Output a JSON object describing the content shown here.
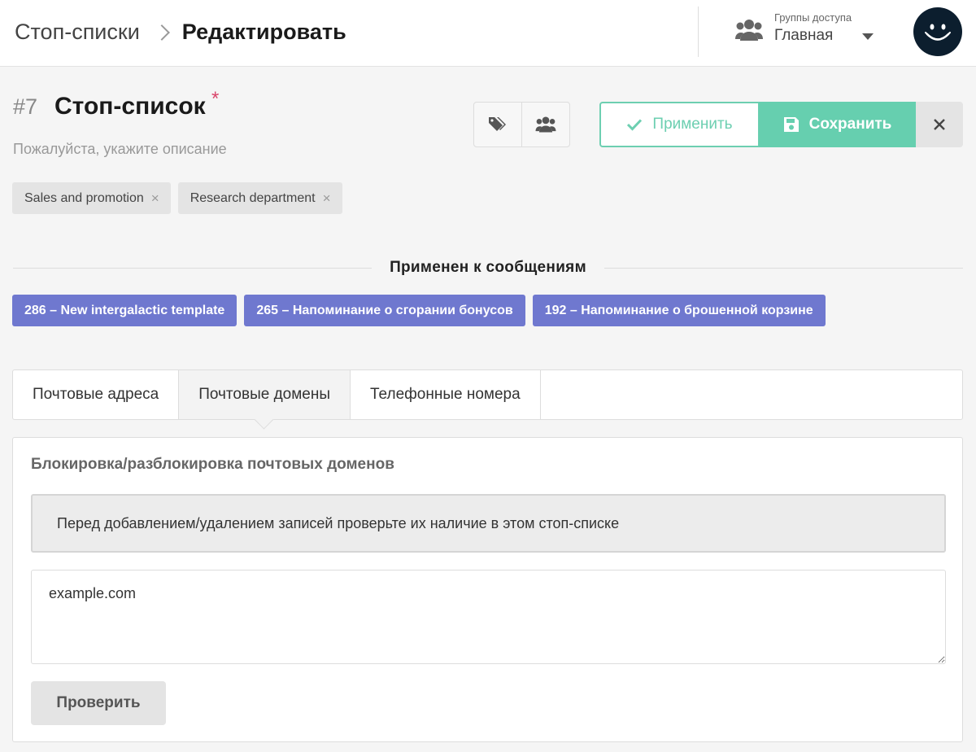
{
  "header": {
    "breadcrumb": [
      "Стоп-списки",
      "Редактировать"
    ],
    "access_group": {
      "label": "Группы доступа",
      "value": "Главная",
      "icon": "users-icon"
    },
    "avatar": {
      "icon": "smiley-face"
    }
  },
  "stoplist": {
    "number": "#7",
    "title": "Стоп-список",
    "required_mark": "*",
    "description_placeholder": "Пожалуйста, укажите описание",
    "tags": [
      {
        "label": "Sales and promotion",
        "remove": "×"
      },
      {
        "label": "Research department",
        "remove": "×"
      }
    ]
  },
  "toolbar": {
    "icons": [
      "tag-icon",
      "users-icon"
    ],
    "apply_label": "Применить",
    "save_label": "Сохранить",
    "close_label": "×"
  },
  "applied_section": {
    "title": "Применен к сообщениям",
    "messages": [
      "286 – New intergalactic template",
      "265 – Напоминание о сгорании бонусов",
      "192 – Напоминание о брошенной корзине"
    ]
  },
  "tabs": [
    {
      "label": "Почтовые адреса",
      "active": false
    },
    {
      "label": "Почтовые домены",
      "active": true
    },
    {
      "label": "Телефонные номера",
      "active": false
    }
  ],
  "panel": {
    "title": "Блокировка/разблокировка почтовых доменов",
    "notice": "Перед добавлением/удалением записей проверьте их наличие в этом стоп-списке",
    "domains_value": "example.com",
    "check_label": "Проверить"
  },
  "colors": {
    "accent_green": "#66cfaf",
    "message_chip": "#6f78cf",
    "required_star": "#d9466b"
  }
}
